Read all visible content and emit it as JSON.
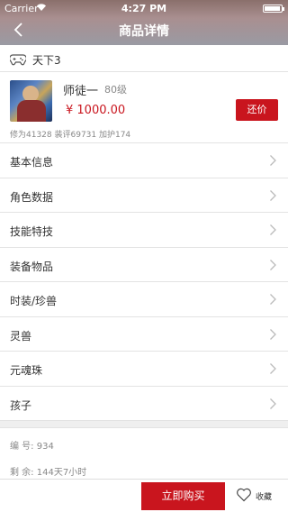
{
  "status_bar": {
    "carrier": "Carrier",
    "time": "4:27 PM"
  },
  "nav": {
    "title": "商品详情"
  },
  "server": {
    "name": "天下3",
    "icon": "gamepad-icon"
  },
  "product": {
    "name": "师徒一",
    "level": "80级",
    "price": "¥ 1000.00",
    "bargain_label": "还价",
    "stats": "修为41328 装评69731 加护174"
  },
  "menu": {
    "items": [
      {
        "label": "基本信息"
      },
      {
        "label": "角色数据"
      },
      {
        "label": "技能特技"
      },
      {
        "label": "装备物品"
      },
      {
        "label": "时装/珍兽"
      },
      {
        "label": "灵兽"
      },
      {
        "label": "元魂珠"
      },
      {
        "label": "孩子"
      }
    ]
  },
  "info": {
    "number": "编 号: 934",
    "remaining": "剩 余: 144天7小时"
  },
  "bottom": {
    "buy_label": "立即购买",
    "favorite_label": "收藏"
  },
  "colors": {
    "accent": "#c9151e"
  }
}
